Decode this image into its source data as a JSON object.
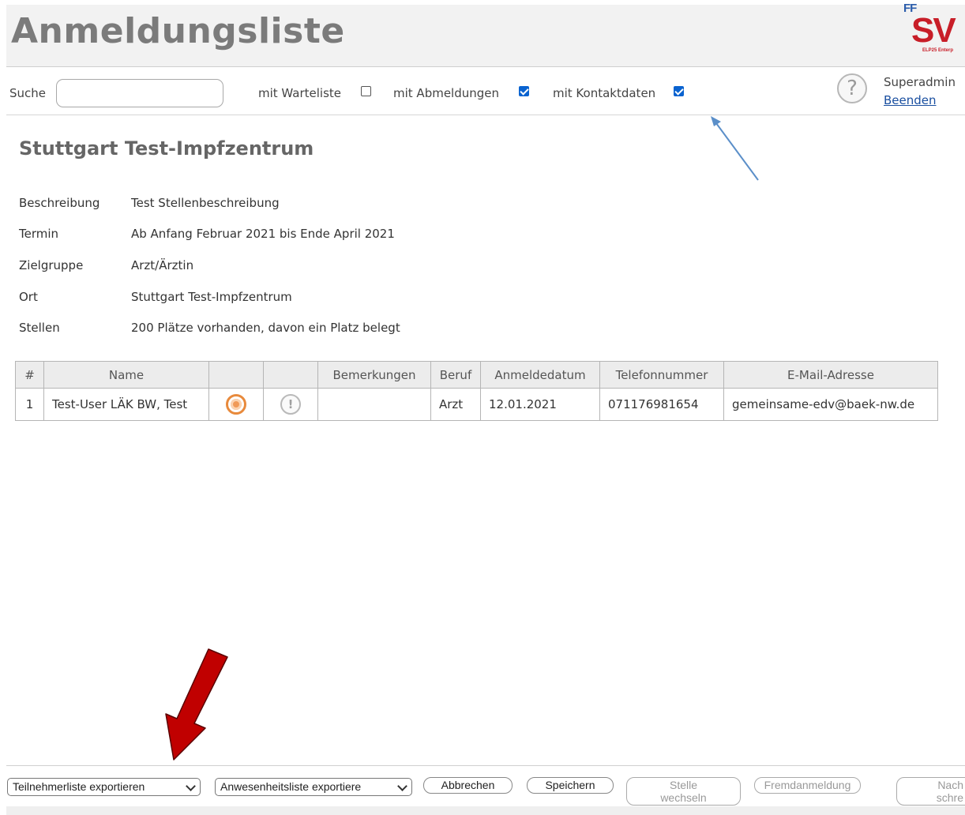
{
  "header": {
    "title": "Anmeldungsliste",
    "logo": {
      "top": "FF",
      "main": "SV",
      "sub": "ELP25 Enterp"
    }
  },
  "filters": {
    "search_label": "Suche",
    "search_value": "",
    "warteliste_label": "mit Warteliste",
    "warteliste_checked": false,
    "abmeldungen_label": "mit Abmeldungen",
    "abmeldungen_checked": true,
    "kontaktdaten_label": "mit Kontaktdaten",
    "kontaktdaten_checked": true
  },
  "user": {
    "help_icon": "question-circle-icon",
    "name": "Superadmin",
    "logout": "Beenden"
  },
  "event": {
    "title": "Stuttgart Test-Impfzentrum",
    "details": [
      {
        "key": "Beschreibung",
        "value": "Test Stellenbeschreibung"
      },
      {
        "key": "Termin",
        "value": "Ab Anfang Februar 2021 bis Ende April 2021"
      },
      {
        "key": "Zielgruppe",
        "value": "Arzt/Ärztin"
      },
      {
        "key": "Ort",
        "value": "Stuttgart Test-Impfzentrum"
      },
      {
        "key": "Stellen",
        "value": "200 Plätze vorhanden, davon ein Platz belegt"
      }
    ]
  },
  "table": {
    "headers": [
      "#",
      "Name",
      "",
      "",
      "Bemerkungen",
      "Beruf",
      "Anmeldedatum",
      "Telefonnummer",
      "E-Mail-Adresse"
    ],
    "rows": [
      {
        "num": "1",
        "name": "Test-User LÄK BW, Test",
        "status_icon": "orange-ring-icon",
        "alert_icon": "exclamation-circle-icon",
        "alert_glyph": "!",
        "remarks": "",
        "profession": "Arzt",
        "date": "12.01.2021",
        "phone": "071176981654",
        "email": "gemeinsame-edv@baek-nw.de"
      }
    ]
  },
  "footer": {
    "export_participants": "Teilnehmerliste exportieren",
    "export_attendance": "Anwesenheitsliste exportiere",
    "cancel": "Abbrechen",
    "save": "Speichern",
    "change_line1": "Stelle",
    "change_line2": "wechseln",
    "external": "Fremdanmeldung",
    "next_line1": "Nach",
    "next_line2": "schre"
  },
  "colors": {
    "title": "#7b7b7b",
    "logo_red": "#c81e28",
    "logo_blue": "#2a5cab",
    "checkbox": "#0a63d0",
    "link": "#1a4fa0",
    "annotation_blue_arrow": "#5b8fc9",
    "annotation_red_arrow": "#c00000"
  }
}
